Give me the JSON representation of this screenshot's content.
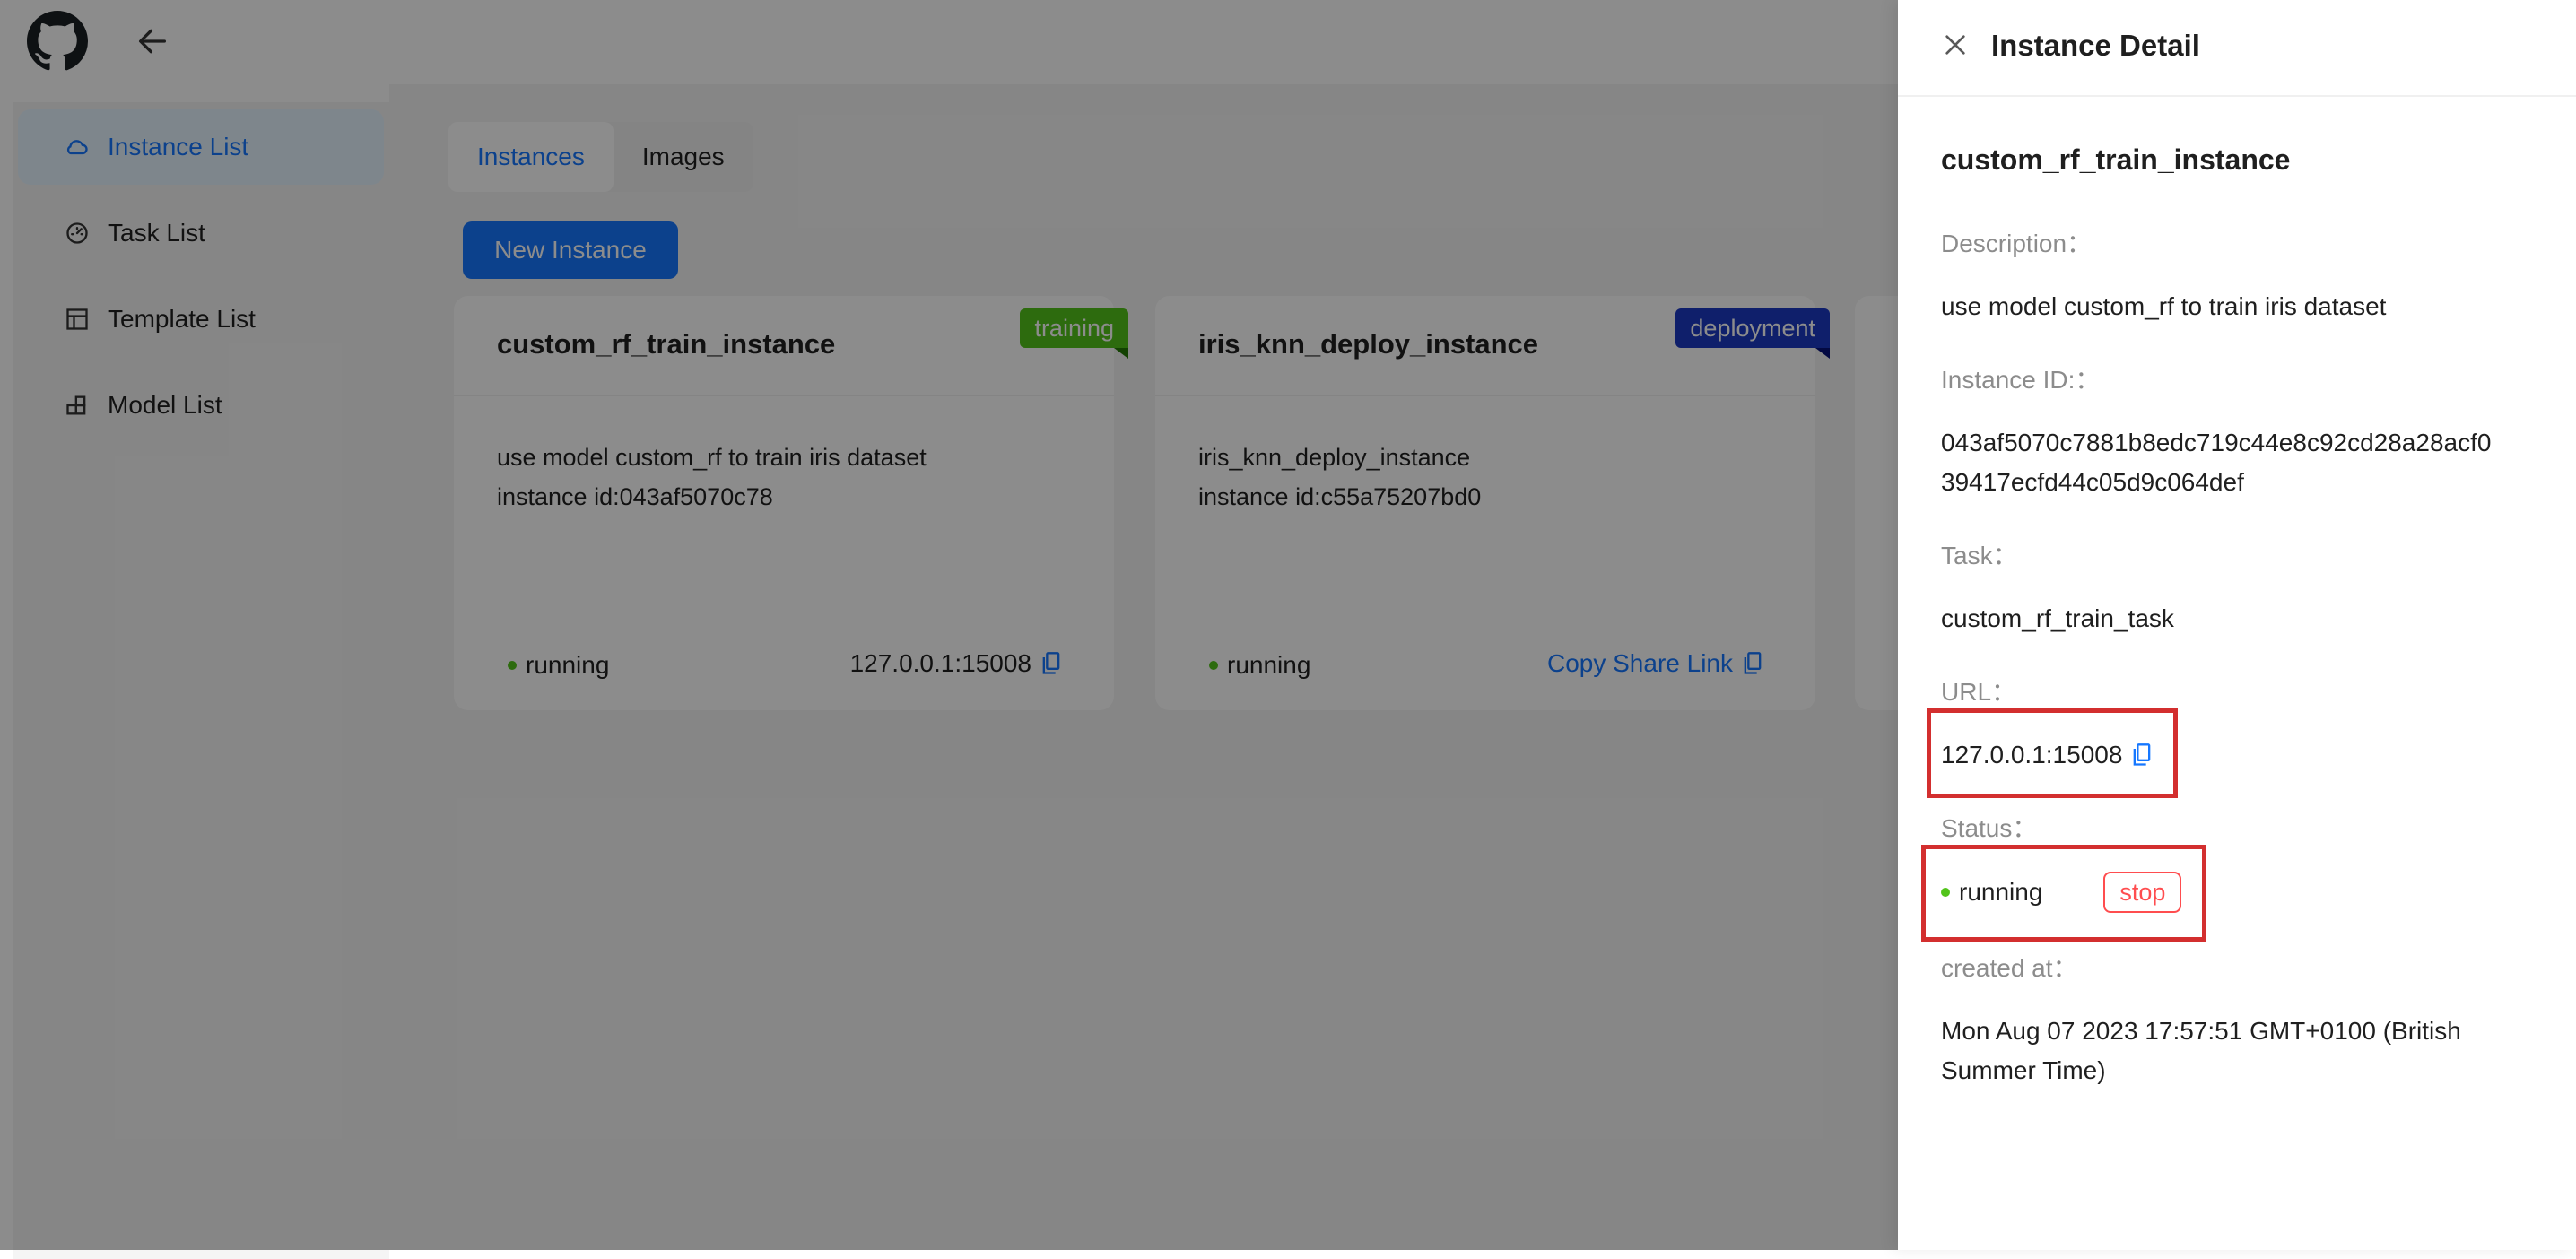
{
  "sidebar": {
    "items": [
      {
        "label": "Instance List",
        "icon": "cloud-icon"
      },
      {
        "label": "Task List",
        "icon": "dashboard-icon"
      },
      {
        "label": "Template List",
        "icon": "layout-icon"
      },
      {
        "label": "Model List",
        "icon": "block-icon"
      }
    ]
  },
  "tabs": [
    {
      "label": "Instances"
    },
    {
      "label": "Images"
    }
  ],
  "new_instance_label": "New Instance",
  "cards": [
    {
      "title": "custom_rf_train_instance",
      "ribbon": "training",
      "ribbon_color": "#52c41a",
      "desc_line1": "use model custom_rf to train iris dataset",
      "desc_line2": "instance id:043af5070c78",
      "status": "running",
      "right_text": "127.0.0.1:15008"
    },
    {
      "title": "iris_knn_deploy_instance",
      "ribbon": "deployment",
      "ribbon_color": "#1d39c4",
      "desc_line1": "iris_knn_deploy_instance",
      "desc_line2": "instance id:c55a75207bd0",
      "status": "running",
      "right_text": "Copy Share Link"
    }
  ],
  "drawer": {
    "title": "Instance Detail",
    "name": "custom_rf_train_instance",
    "description_label": "Description：",
    "description": "use model custom_rf to train iris dataset",
    "id_label": "Instance ID:：",
    "id_line1": "043af5070c7881b8edc719c44e8c92cd28a28acf0",
    "id_line2": "39417ecfd44c05d9c064def",
    "task_label": "Task：",
    "task": "custom_rf_train_task",
    "url_label": "URL：",
    "url": "127.0.0.1:15008",
    "status_label": "Status：",
    "status": "running",
    "stop_label": "stop",
    "created_label": "created at：",
    "created_line1": "Mon Aug 07 2023 17:57:51 GMT+0100 (British",
    "created_line2": "Summer Time)"
  },
  "colors": {
    "primary": "#1677ff",
    "success": "#52c41a",
    "danger": "#ff4d4f",
    "highlight": "#d32f2f"
  }
}
